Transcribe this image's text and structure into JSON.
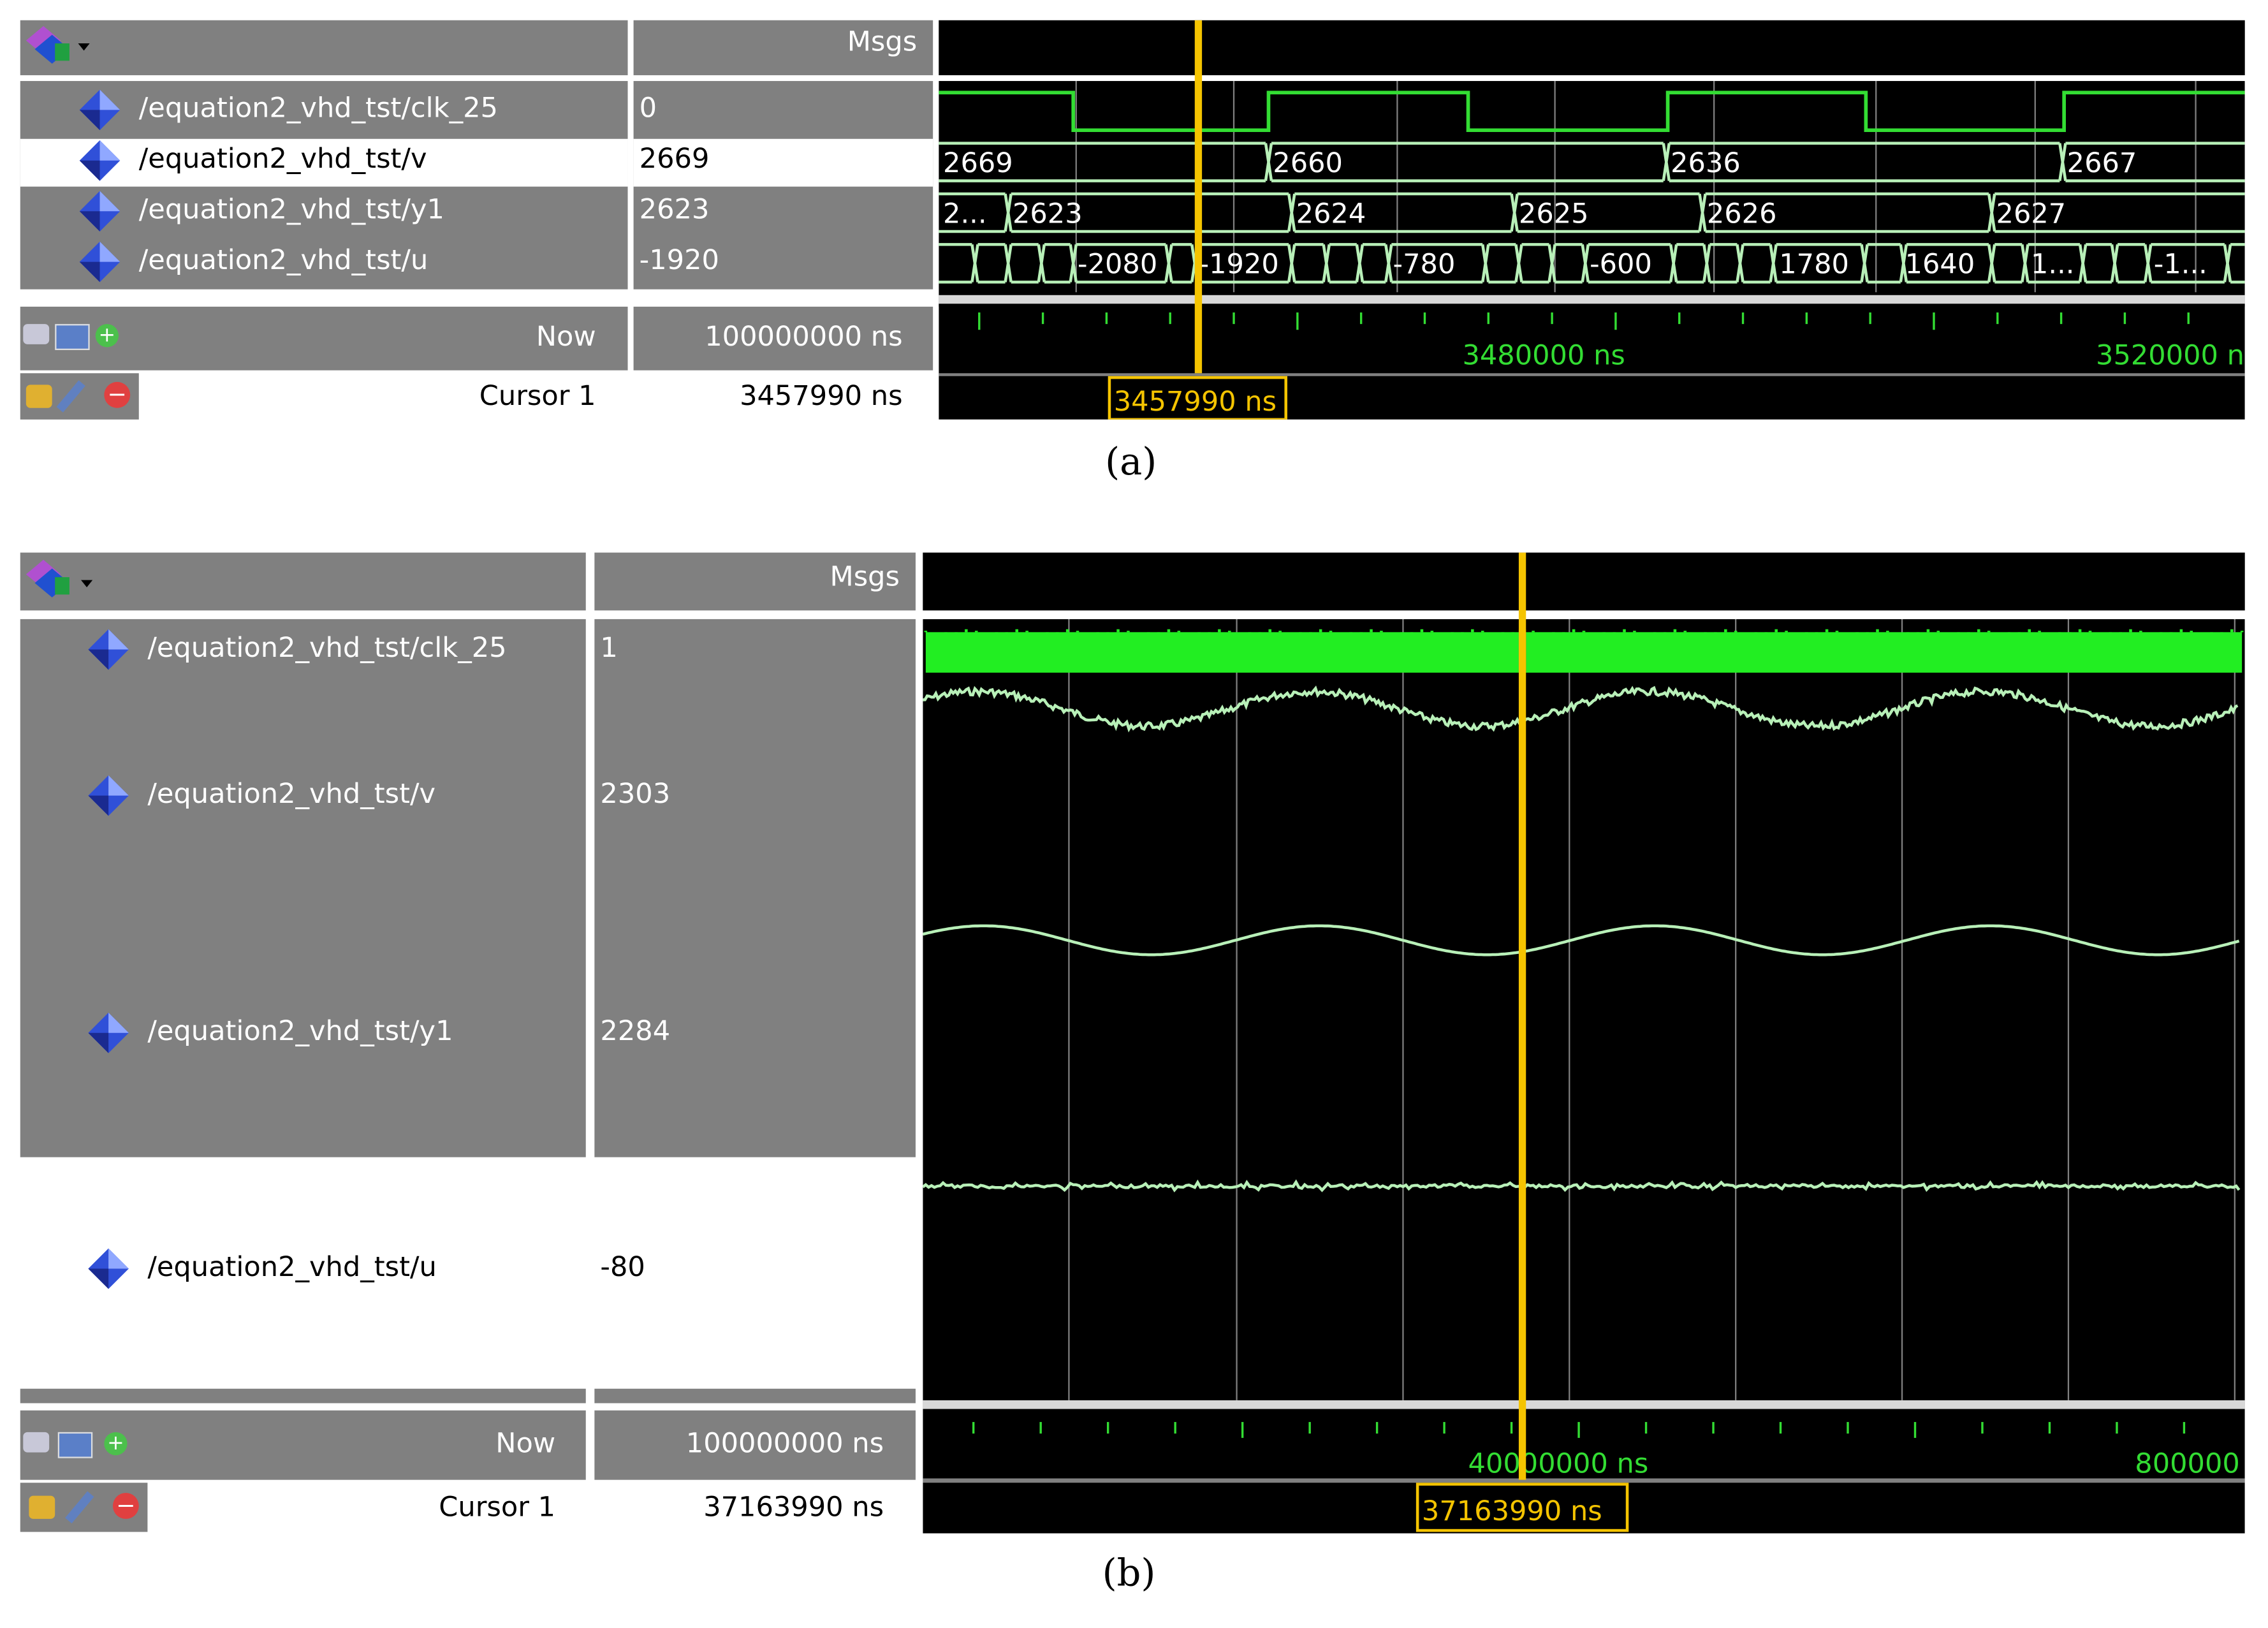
{
  "panel_a": {
    "caption": "(a)",
    "header": {
      "msgs_label": "Msgs"
    },
    "signals": [
      {
        "name": "/equation2_vhd_tst/clk_25",
        "value": "0"
      },
      {
        "name": "/equation2_vhd_tst/v",
        "value": "2669",
        "wave_labels": [
          "2669",
          "2660",
          "2636",
          "2667"
        ]
      },
      {
        "name": "/equation2_vhd_tst/y1",
        "value": "2623",
        "wave_labels": [
          "2...",
          "2623",
          "2624",
          "2625",
          "2626",
          "2627"
        ]
      },
      {
        "name": "/equation2_vhd_tst/u",
        "value": "-1920",
        "wave_labels": [
          "-2080",
          "-1920",
          "-780",
          "-600",
          "1780",
          "1640",
          "1...",
          "-1..."
        ]
      }
    ],
    "now": {
      "label": "Now",
      "value": "100000000 ns"
    },
    "cursor": {
      "label": "Cursor 1",
      "value": "3457990 ns",
      "marker": "3457990 ns"
    },
    "timeline_labels": [
      "3480000 ns",
      "3520000 n"
    ]
  },
  "panel_b": {
    "caption": "(b)",
    "header": {
      "msgs_label": "Msgs"
    },
    "signals": [
      {
        "name": "/equation2_vhd_tst/clk_25",
        "value": "1"
      },
      {
        "name": "/equation2_vhd_tst/v",
        "value": "2303"
      },
      {
        "name": "/equation2_vhd_tst/y1",
        "value": "2284"
      },
      {
        "name": "/equation2_vhd_tst/u",
        "value": "-80"
      }
    ],
    "now": {
      "label": "Now",
      "value": "100000000 ns"
    },
    "cursor": {
      "label": "Cursor 1",
      "value": "37163990 ns",
      "marker": "37163990 ns"
    },
    "timeline_labels": [
      "40000000 ns",
      "800000"
    ]
  },
  "colors": {
    "wave_green": "#33dd33",
    "bus_green": "#b8f0b8",
    "cursor_yellow": "#f5c400",
    "grid": "#808080"
  },
  "icons": [
    "wave-toolbar-icon",
    "signal-diamond-icon",
    "zoom-icon",
    "monitor-icon",
    "add-icon",
    "lock-icon",
    "wrench-icon",
    "remove-icon"
  ]
}
